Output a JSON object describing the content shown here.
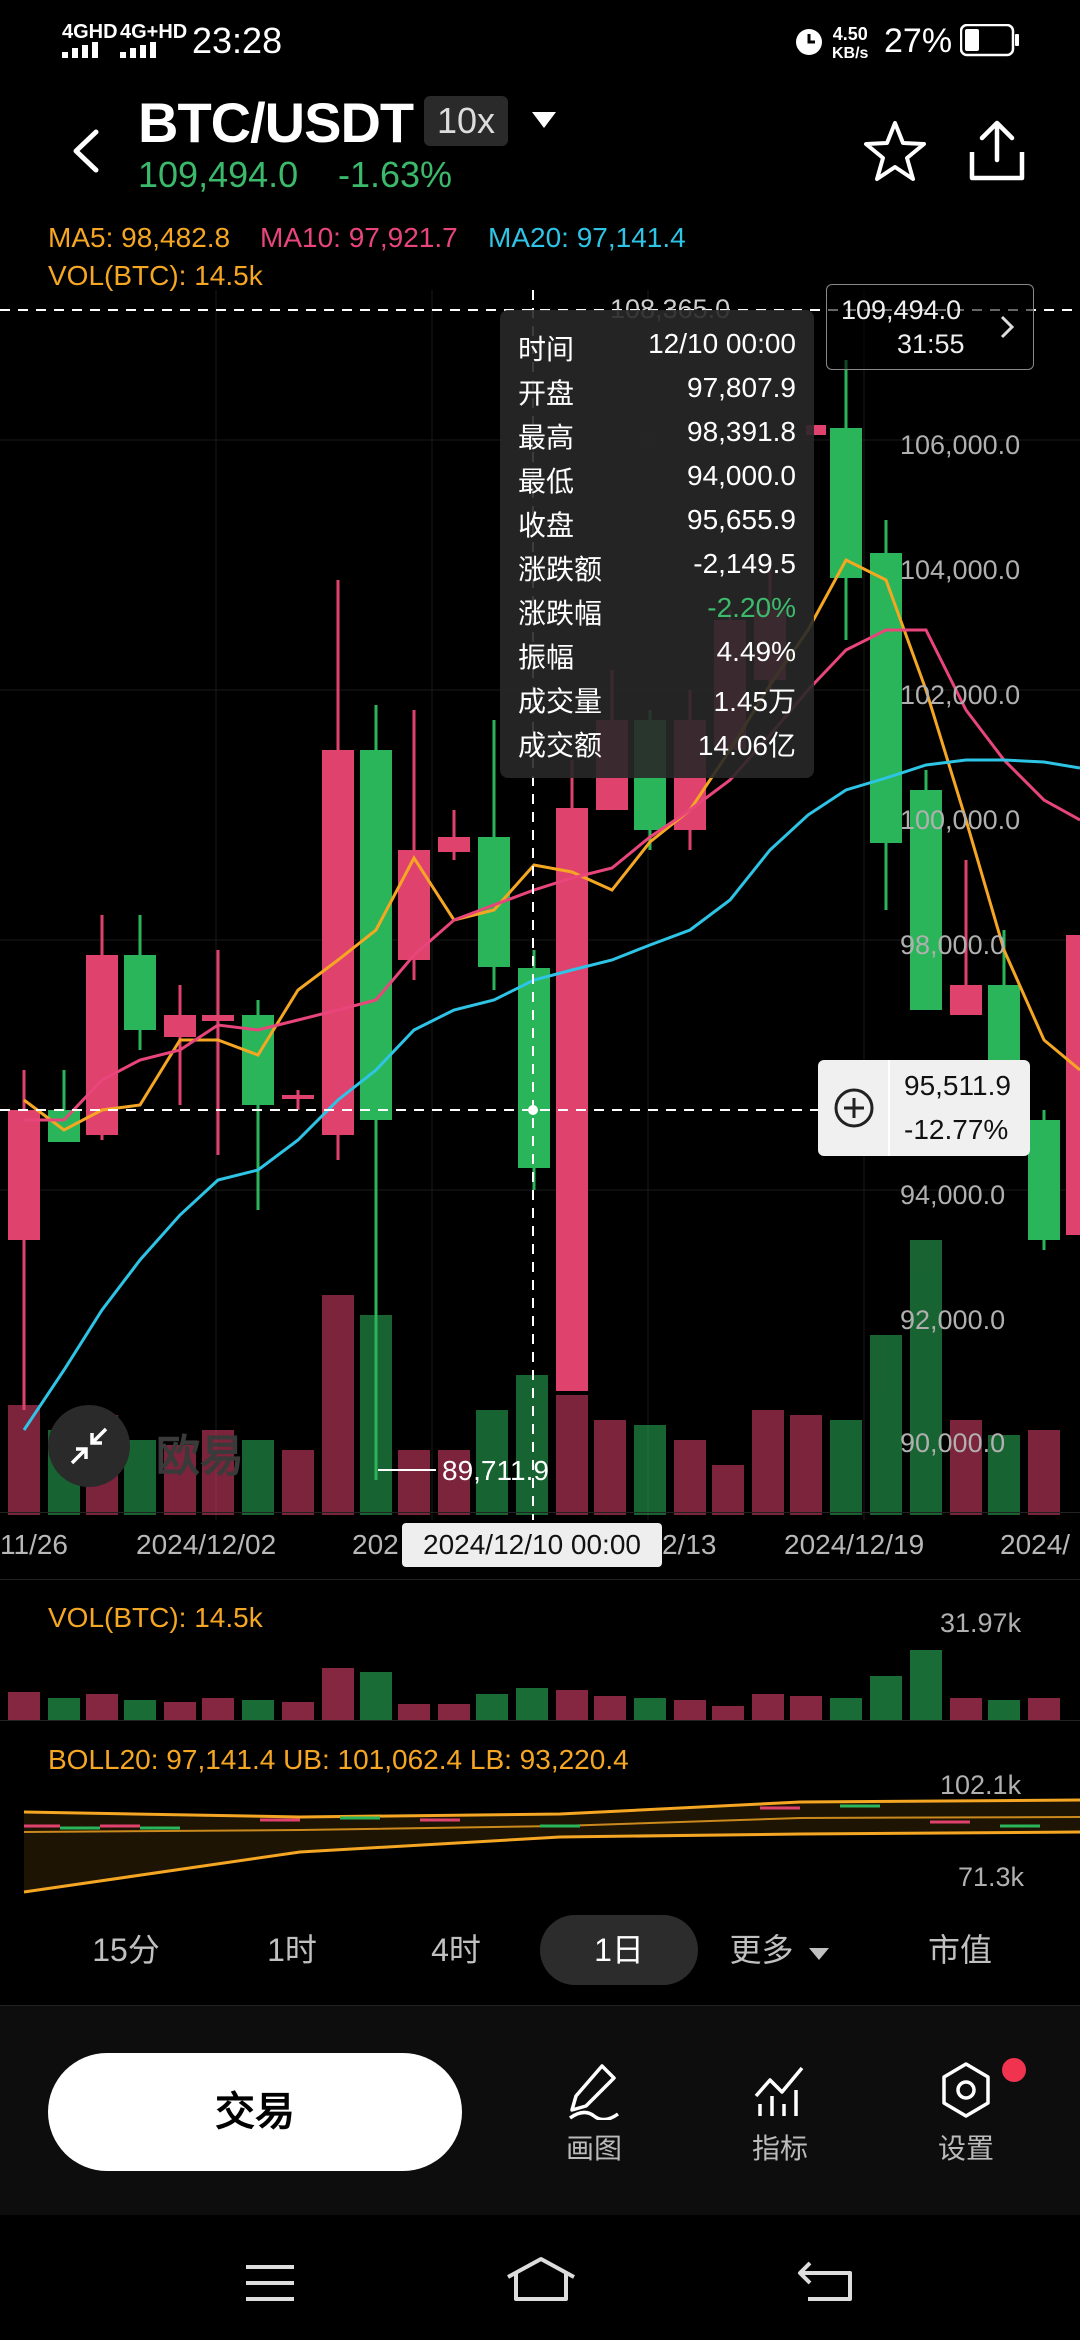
{
  "status_bar": {
    "network1": "4GHD",
    "network2": "4G+HD",
    "time": "23:28",
    "speed_value": "4.50",
    "speed_unit": "KB/s",
    "battery": "27%"
  },
  "header": {
    "pair": "BTC/USDT",
    "leverage": "10x",
    "last_price": "109,494.0",
    "change_pct": "-1.63%"
  },
  "indicators": {
    "ma5": "MA5: 98,482.8",
    "ma10": "MA10: 97,921.7",
    "ma20": "MA20: 97,141.4",
    "vol": "VOL(BTC): 14.5k",
    "colors": {
      "ma5": "#f5a623",
      "ma10": "#e8457b",
      "ma20": "#2ec4e6",
      "up": "#2bb55a",
      "down": "#e0426e"
    }
  },
  "price_axis": [
    "106,000.0",
    "104,000.0",
    "102,000.0",
    "100,000.0",
    "98,000.0",
    "94,000.0",
    "92,000.0",
    "90,000.0"
  ],
  "high_marker": "108,365.0",
  "current_price_tag": {
    "price": "109,494.0",
    "countdown": "31:55"
  },
  "low_marker": "89,711.9",
  "crosshair": {
    "price": "95,511.9",
    "pct": "-12.77%",
    "date": "2024/12/10 00:00"
  },
  "x_axis": [
    "11/26",
    "2024/12/02",
    "202",
    "2/13",
    "2024/12/19",
    "2024/"
  ],
  "tooltip": [
    {
      "k": "时间",
      "v": "12/10 00:00"
    },
    {
      "k": "开盘",
      "v": "97,807.9"
    },
    {
      "k": "最高",
      "v": "98,391.8"
    },
    {
      "k": "最低",
      "v": "94,000.0"
    },
    {
      "k": "收盘",
      "v": "95,655.9"
    },
    {
      "k": "涨跌额",
      "v": "-2,149.5"
    },
    {
      "k": "涨跌幅",
      "v": "-2.20%"
    },
    {
      "k": "振幅",
      "v": "4.49%"
    },
    {
      "k": "成交量",
      "v": "1.45万"
    },
    {
      "k": "成交额",
      "v": "14.06亿"
    }
  ],
  "watermark": "欧易",
  "vol_panel": {
    "label": "VOL(BTC): 14.5k",
    "max": "31.97k"
  },
  "boll_panel": {
    "label": "BOLL20: 97,141.4 UB: 101,062.4 LB: 93,220.4",
    "top": "102.1k",
    "bottom": "71.3k"
  },
  "timeframes": [
    "15分",
    "1时",
    "4时",
    "1日",
    "更多",
    "市值"
  ],
  "active_timeframe": "1日",
  "bottom_bar": {
    "trade": "交易",
    "draw": "画图",
    "indicator": "指标",
    "settings": "设置"
  }
}
